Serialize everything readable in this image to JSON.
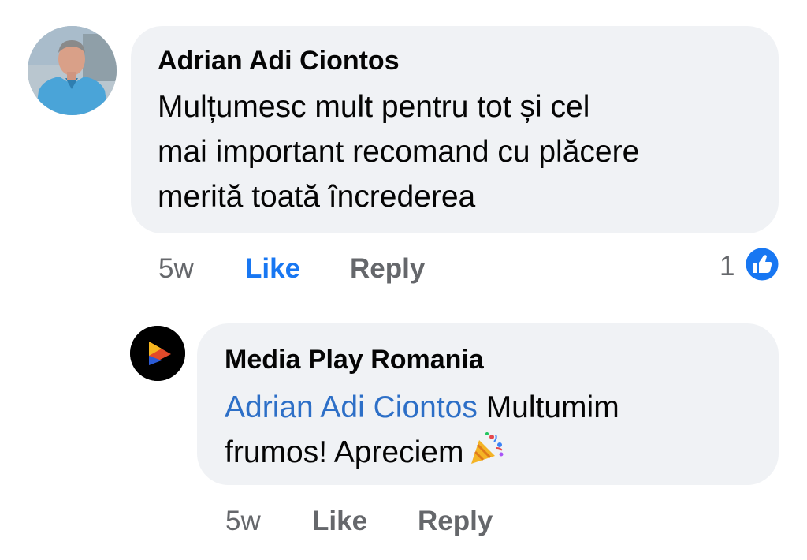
{
  "comments": [
    {
      "author": "Adrian Adi Ciontos",
      "text_lines": [
        "Mulțumesc mult pentru tot și cel",
        "mai important recomand cu plăcere",
        "merită toată încrederea"
      ],
      "time": "5w",
      "like_label": "Like",
      "reply_label": "Reply",
      "reaction_count": "1",
      "reaction_icon": "like-thumb-icon",
      "avatar": "profile-photo-man"
    },
    {
      "author": "Media Play Romania",
      "mention": "Adrian Adi Ciontos",
      "text_line_1_rest": " Multumim",
      "text_line_2": "frumos! Apreciem",
      "emoji": "party-popper-icon",
      "time": "5w",
      "like_label": "Like",
      "reply_label": "Reply",
      "avatar": "play-logo"
    }
  ],
  "colors": {
    "bubble_bg": "#f0f2f5",
    "meta_text": "#65676b",
    "like_active": "#1877f2",
    "mention": "#2d6fc7"
  }
}
